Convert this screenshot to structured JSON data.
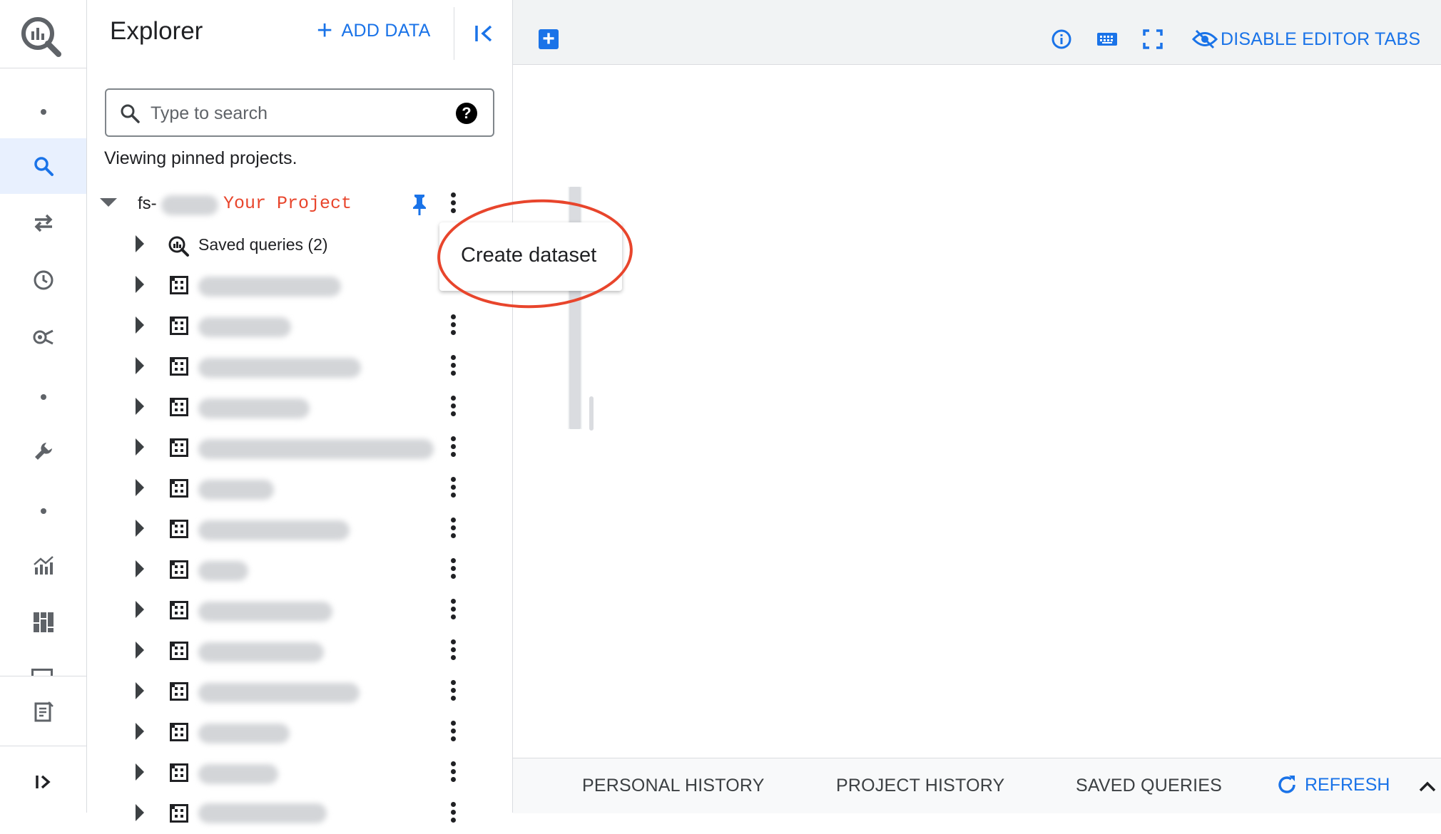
{
  "rail": {
    "items": [
      {
        "icon": "dot"
      },
      {
        "icon": "search-icon",
        "active": true
      },
      {
        "icon": "transfers-icon"
      },
      {
        "icon": "history-icon"
      },
      {
        "icon": "analytics-hub-icon"
      },
      {
        "icon": "dot"
      },
      {
        "icon": "wrench-icon"
      },
      {
        "icon": "dot"
      },
      {
        "icon": "monitoring-chart-icon"
      },
      {
        "icon": "dashboard-icon"
      },
      {
        "icon": "release-notes-icon"
      },
      {
        "icon": "expand-panel-icon"
      }
    ]
  },
  "explorer": {
    "title": "Explorer",
    "add_data_label": "ADD DATA",
    "search_placeholder": "Type to search",
    "help_glyph": "?",
    "viewing_text": "Viewing pinned projects.",
    "project": {
      "prefix": "fs-",
      "label": "Your Project",
      "pinned": true
    },
    "saved_queries_label": "Saved queries (2)",
    "dataset_count_visible": 13
  },
  "context_menu": {
    "items": [
      "Create dataset"
    ],
    "highlight_color": "#e8452c"
  },
  "editor_toolbar": {
    "disable_tabs_label": "DISABLE EDITOR TABS"
  },
  "bottom_bar": {
    "tabs": [
      "PERSONAL HISTORY",
      "PROJECT HISTORY",
      "SAVED QUERIES"
    ],
    "refresh_label": "REFRESH"
  },
  "colors": {
    "accent": "#1a73e8",
    "annotation": "#e8452c",
    "active_rail_bg": "#e8f0fe"
  }
}
